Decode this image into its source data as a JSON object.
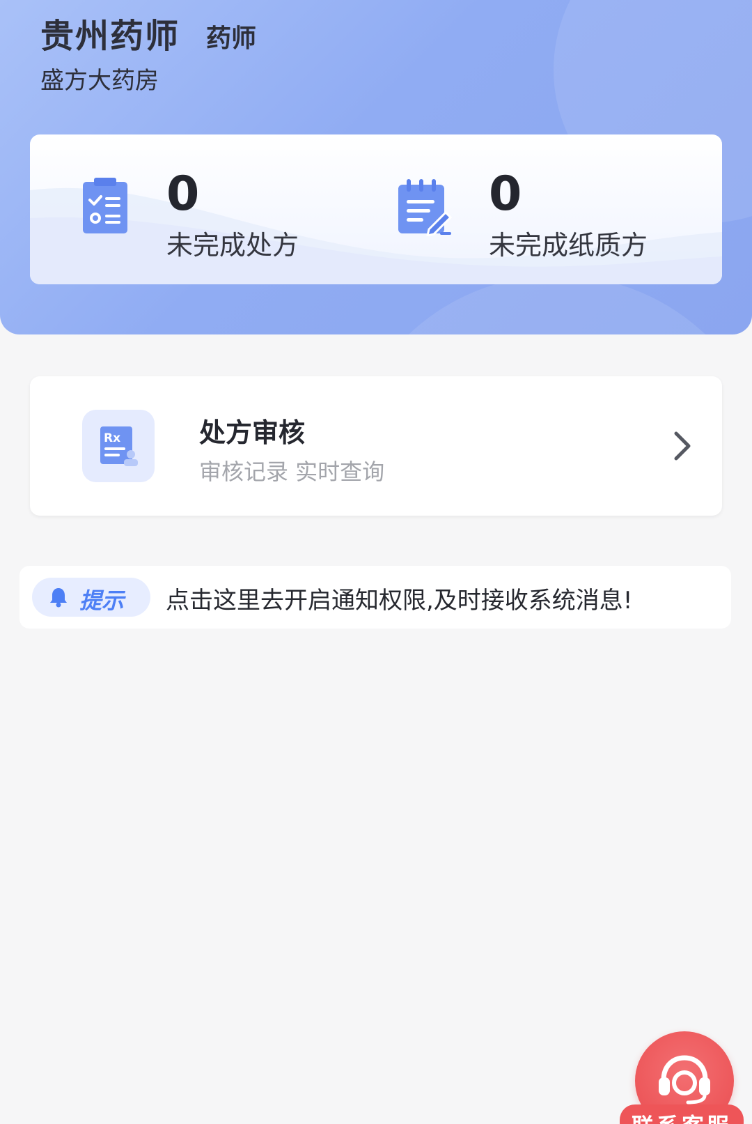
{
  "header": {
    "user_name": "贵州药师",
    "user_role": "药师",
    "store_name": "盛方大药房"
  },
  "stats": [
    {
      "value": "0",
      "label": "未完成处方",
      "icon": "clipboard-checklist-icon"
    },
    {
      "value": "0",
      "label": "未完成纸质方",
      "icon": "notepad-edit-icon"
    }
  ],
  "audit": {
    "title": "处方审核",
    "subtitle": "审核记录 实时查询",
    "icon": "rx-document-icon",
    "arrow_icon": "chevron-right-icon"
  },
  "tip": {
    "badge_label": "提示",
    "badge_icon": "bell-icon",
    "message": "点击这里去开启通知权限,及时接收系统消息!"
  },
  "service": {
    "label": "联系客服",
    "icon": "headset-icon"
  },
  "colors": {
    "header_blue": "#8ba6f0",
    "icon_blue": "#5f86ee",
    "tip_blue": "#4d7ff5",
    "service_red": "#ee5a5d",
    "background": "#f6f6f7"
  }
}
